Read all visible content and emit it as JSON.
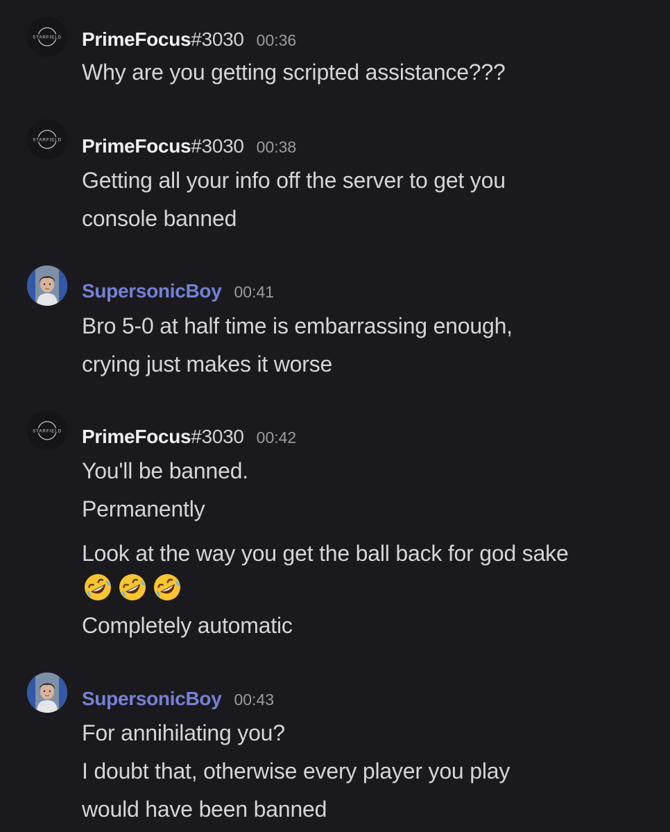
{
  "avatars": {
    "starfield_text": "STARFIELD"
  },
  "messages": [
    {
      "username": "PrimeFocus",
      "tag": "#3030",
      "time": "00:36",
      "lines": [
        "Why are you getting scripted assistance???"
      ]
    },
    {
      "username": "PrimeFocus",
      "tag": "#3030",
      "time": "00:38",
      "lines": [
        "Getting all your info off the server to get you",
        "console banned"
      ]
    },
    {
      "username": "SupersonicBoy",
      "tag": "",
      "time": "00:41",
      "lines": [
        "Bro 5-0 at half time is embarrassing enough,",
        "crying just makes it worse"
      ]
    },
    {
      "username": "PrimeFocus",
      "tag": "#3030",
      "time": "00:42",
      "lines": [
        "You'll be banned.",
        "Permanently",
        "Look at the way you get the ball back for god sake",
        "Completely automatic"
      ],
      "emoji_line": [
        "rolling-on-floor-laughing",
        "rolling-on-floor-laughing",
        "rolling-on-floor-laughing"
      ]
    },
    {
      "username": "SupersonicBoy",
      "tag": "",
      "time": "00:43",
      "lines": [
        "For annihilating you?",
        "I doubt that, otherwise every player you play",
        "would have been banned"
      ]
    }
  ],
  "colors": {
    "background": "#1a1a1e",
    "username_default": "#eef0f3",
    "username_supersonic": "#7581d6",
    "message_text": "#d4d5d9",
    "timestamp": "#9a9ca3"
  }
}
